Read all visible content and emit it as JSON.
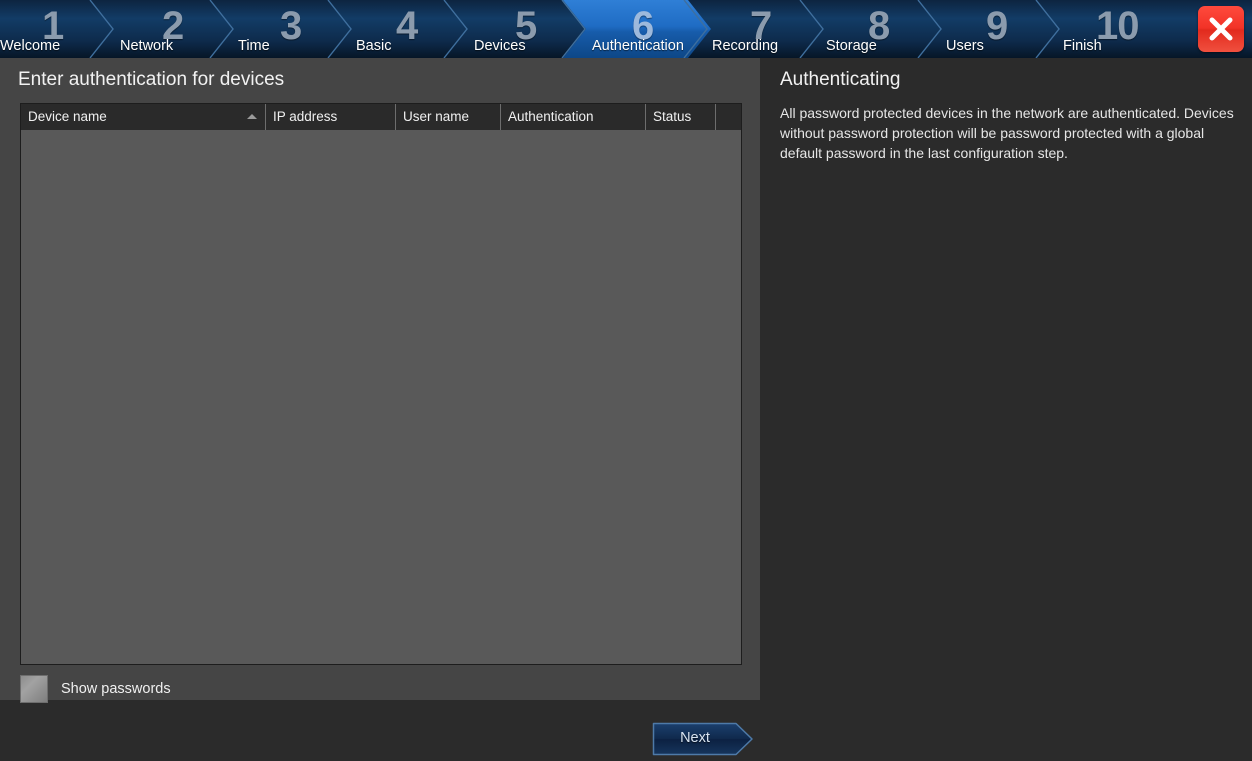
{
  "window": {
    "close_label": "Close",
    "accent_blue": "#1a6fd0",
    "bar_dark": "#0d2440",
    "close_red": "#f23227",
    "panel_left_bg": "#454545",
    "panel_right_bg": "#2b2b2b",
    "table_bg": "#595959"
  },
  "wizard": {
    "steps": [
      {
        "num": "1",
        "label": "Welcome",
        "active": false
      },
      {
        "num": "2",
        "label": "Network",
        "active": false
      },
      {
        "num": "3",
        "label": "Time",
        "active": false
      },
      {
        "num": "4",
        "label": "Basic",
        "active": false
      },
      {
        "num": "5",
        "label": "Devices",
        "active": false
      },
      {
        "num": "6",
        "label": "Authentication",
        "active": true
      },
      {
        "num": "7",
        "label": "Recording",
        "active": false
      },
      {
        "num": "8",
        "label": "Storage",
        "active": false
      },
      {
        "num": "9",
        "label": "Users",
        "active": false
      },
      {
        "num": "10",
        "label": "Finish",
        "active": false
      }
    ]
  },
  "main": {
    "title": "Enter authentication for devices",
    "table": {
      "columns": [
        "Device name",
        "IP address",
        "User name",
        "Authentication",
        "Status",
        ""
      ],
      "sorted_column": "Device name",
      "sort_direction": "ascending",
      "rows": []
    },
    "show_passwords": {
      "label": "Show passwords",
      "checked": false
    },
    "next_button": "Next"
  },
  "help": {
    "title": "Authenticating",
    "paragraphs": [
      "All password protected devices in the network are authenticated. Devices without password protection will be password protected with a global default password in the last configuration step."
    ]
  }
}
